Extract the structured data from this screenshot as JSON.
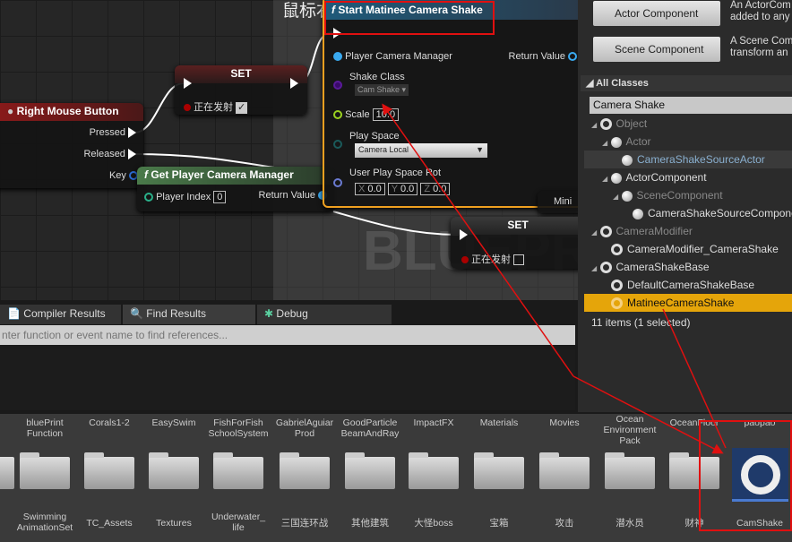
{
  "graph": {
    "comment_title": "鼠标右",
    "watermark": "BLUEPRI",
    "rmb": {
      "title": "Right Mouse Button",
      "pressed": "Pressed",
      "released": "Released",
      "key": "Key"
    },
    "set1": {
      "title": "SET",
      "var": "正在发射",
      "checked": true
    },
    "set2": {
      "title": "SET",
      "var": "正在发射",
      "checked": false
    },
    "gpcm": {
      "title": "Get Player Camera Manager",
      "player_index_label": "Player Index",
      "player_index": "0",
      "return_value": "Return Value"
    },
    "smcs": {
      "title": "Start Matinee Camera Shake",
      "pcm": "Player Camera Manager",
      "return_value": "Return Value",
      "shake_class_label": "Shake Class",
      "shake_class": "Cam Shake",
      "scale_label": "Scale",
      "scale": "10.0",
      "play_space_label": "Play Space",
      "play_space": "Camera Local",
      "rot_label": "User Play Space Rot",
      "x_label": "X",
      "x": "0.0",
      "y_label": "Y",
      "y": "0.0",
      "z_label": "Z",
      "z": "0.0"
    },
    "mini": "Mini"
  },
  "bottom_tabs": [
    {
      "label": "Compiler Results"
    },
    {
      "label": "Find Results"
    },
    {
      "label": "Debug"
    }
  ],
  "find": {
    "placeholder": "nter function or event name to find references..."
  },
  "class_picker": {
    "buttons": [
      {
        "label": "Actor Component",
        "desc": "An ActorCom",
        "desc2": "added to any"
      },
      {
        "label": "Scene Component",
        "desc": "A Scene Com",
        "desc2": "transform an"
      }
    ],
    "section": "All Classes",
    "search": "Camera Shake",
    "items": [
      {
        "label": "Object",
        "icon": "ring"
      },
      {
        "label": "Actor",
        "icon": "ball"
      },
      {
        "label": "CameraShakeSourceActor",
        "icon": "ball"
      },
      {
        "label": "ActorComponent",
        "icon": "component"
      },
      {
        "label": "SceneComponent",
        "icon": "component"
      },
      {
        "label": "CameraShakeSourceComponent",
        "icon": "component"
      },
      {
        "label": "CameraModifier",
        "icon": "ring"
      },
      {
        "label": "CameraModifier_CameraShake",
        "icon": "ring"
      },
      {
        "label": "CameraShakeBase",
        "icon": "ring"
      },
      {
        "label": "DefaultCameraShakeBase",
        "icon": "ring"
      },
      {
        "label": "MatineeCameraShake",
        "icon": "ring",
        "selected": true
      }
    ],
    "status": "11 items (1 selected)"
  },
  "content_browser": {
    "top_labels": [
      "bluePrint\nFunction",
      "Corals1-2",
      "EasySwim",
      "FishForFish\nSchoolSystem",
      "GabrielAguiar\nProd",
      "GoodParticle\nBeamAndRay",
      "ImpactFX",
      "Materials",
      "Movies",
      "Ocean\nEnvironment\nPack",
      "OceanFloor",
      "paopao"
    ],
    "bottom_labels": [
      "Swimming\nAnimationSet",
      "TC_Assets",
      "Textures",
      "Underwater_\nlife",
      "三国连环战",
      "其他建筑",
      "大怪boss",
      "宝箱",
      "攻击",
      "潜水员",
      "财神",
      "CamShake"
    ]
  },
  "colors": {
    "accent_selected": "#e5a50a",
    "annotation": "#e01010",
    "node_orange": "#f0a020"
  }
}
